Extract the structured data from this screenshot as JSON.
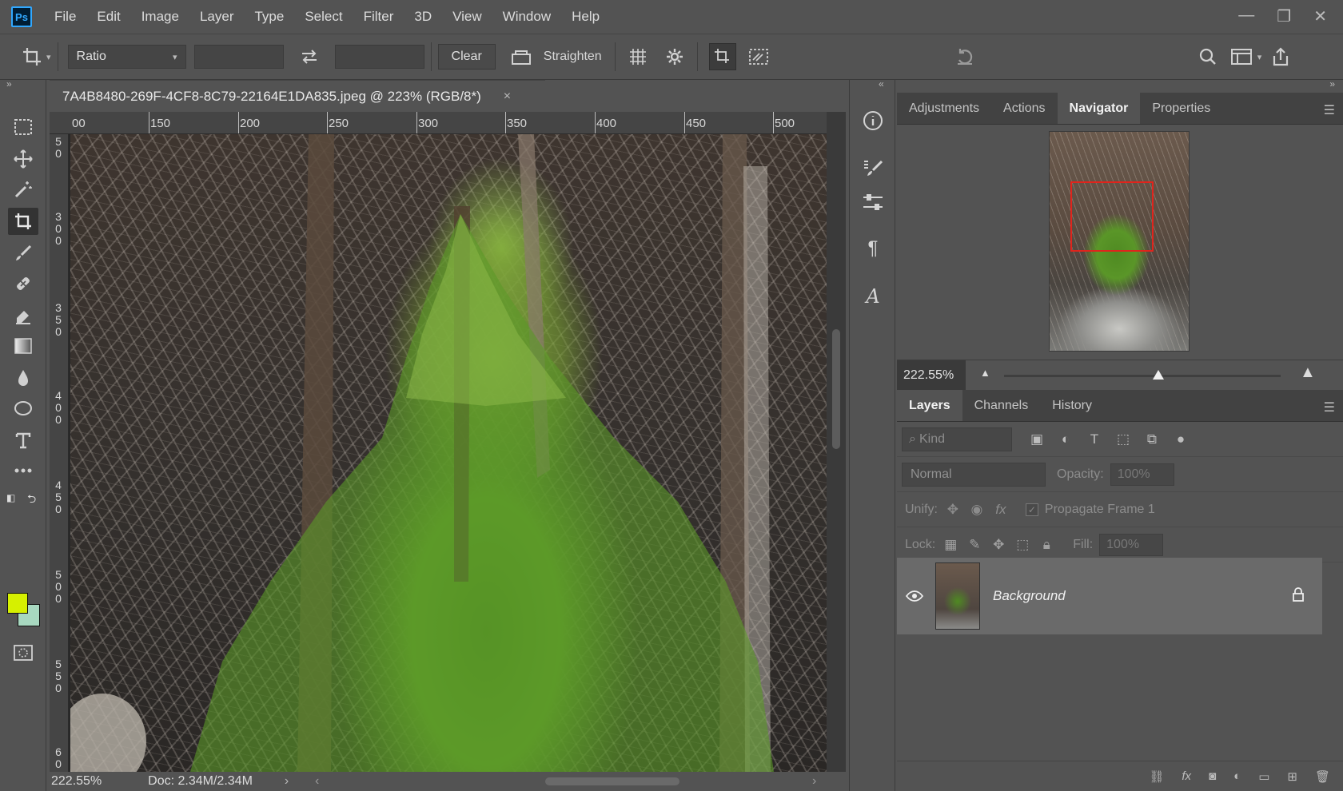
{
  "app": {
    "logo": "Ps"
  },
  "menu": [
    "File",
    "Edit",
    "Image",
    "Layer",
    "Type",
    "Select",
    "Filter",
    "3D",
    "View",
    "Window",
    "Help"
  ],
  "options": {
    "ratio_label": "Ratio",
    "width_value": "",
    "height_value": "",
    "clear_label": "Clear",
    "straighten_label": "Straighten"
  },
  "document": {
    "tab_title": "7A4B8480-269F-4CF8-8C79-22164E1DA835.jpeg @ 223% (RGB/8*)",
    "close_glyph": "×",
    "ruler_top": [
      "00",
      "150",
      "200",
      "250",
      "300",
      "350",
      "400",
      "450",
      "500"
    ],
    "ruler_left": [
      "5 0",
      "3 0 0",
      "3 5 0",
      "4 0 0",
      "4 5 0",
      "5 0 0",
      "5 5 0",
      "6 0"
    ],
    "zoom": "222.55%",
    "doc_info": "Doc: 2.34M/2.34M",
    "status_arrow": "›"
  },
  "colors": {
    "foreground": "#d6f000",
    "background": "#a8d8c0",
    "nav_rect": "#e0241c"
  },
  "navigator_panel": {
    "tabs": [
      "Adjustments",
      "Actions",
      "Navigator",
      "Properties"
    ],
    "active_tab": "Navigator",
    "zoom_value": "222.55%"
  },
  "layers_panel": {
    "tabs": [
      "Layers",
      "Channels",
      "History"
    ],
    "active_tab": "Layers",
    "kind_label": "Kind",
    "blend_mode": "Normal",
    "opacity_label": "Opacity:",
    "opacity_value": "100%",
    "unify_label": "Unify:",
    "propagate_label": "Propagate Frame 1",
    "lock_label": "Lock:",
    "fill_label": "Fill:",
    "fill_value": "100%",
    "layers": [
      {
        "name": "Background",
        "visible": true,
        "locked": true
      }
    ]
  }
}
